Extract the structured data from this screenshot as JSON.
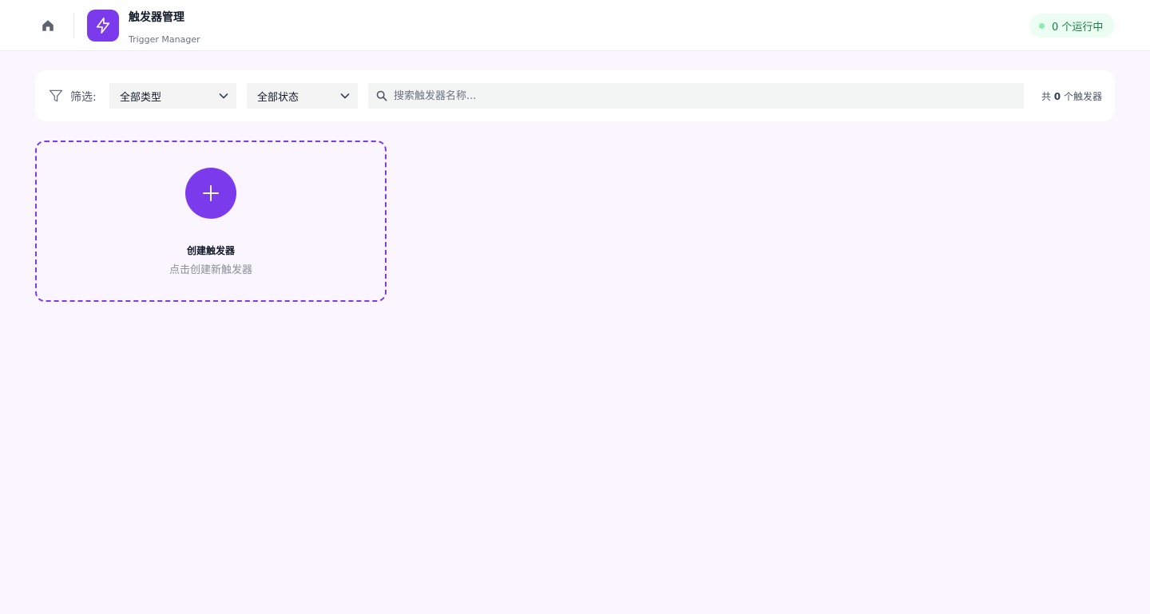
{
  "header": {
    "title": "触发器管理",
    "subtitle": "Trigger Manager",
    "home_icon": "home-icon",
    "logo_icon": "lightning-icon",
    "status_text": "0 个运行中"
  },
  "filters": {
    "label": "筛选:",
    "type_select": "全部类型",
    "status_select": "全部状态",
    "search_placeholder": "搜索触发器名称...",
    "count_prefix": "共",
    "count_value": "0",
    "count_suffix": "个触发器"
  },
  "create_card": {
    "title": "创建触发器",
    "subtitle": "点击创建新触发器"
  },
  "colors": {
    "accent": "#7c3aed",
    "status_bg": "#ecfdf3",
    "status_text": "#15803d",
    "page_bg": "#faf5fe"
  }
}
